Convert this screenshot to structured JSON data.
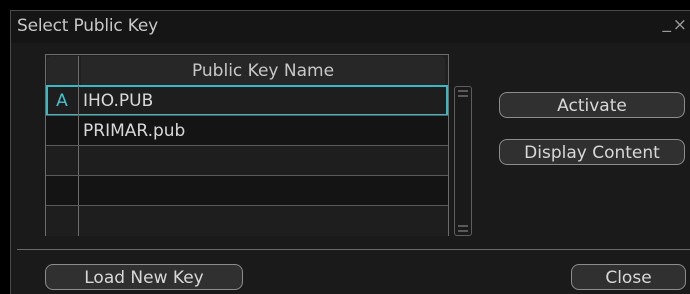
{
  "dialog": {
    "title": "Select Public Key",
    "minimize_glyph": "_",
    "close_glyph": "×"
  },
  "table": {
    "header": {
      "marker": "",
      "name": "Public Key Name"
    },
    "rows": [
      {
        "marker": "A",
        "name": "IHO.PUB"
      },
      {
        "marker": "",
        "name": "PRIMAR.pub"
      },
      {
        "marker": "",
        "name": ""
      },
      {
        "marker": "",
        "name": ""
      },
      {
        "marker": "",
        "name": ""
      }
    ],
    "selected_index": 0
  },
  "buttons": {
    "activate": "Activate",
    "display_content": "Display Content",
    "load_new_key": "Load New Key",
    "close": "Close"
  },
  "colors": {
    "accent": "#39b8c6",
    "marker_text": "#42c4cc",
    "background": "#1a1a1a"
  },
  "icons": {
    "minimize": "minimize-icon",
    "close": "close-icon",
    "scroll_up": "scroll-up-grip-icon",
    "scroll_down": "scroll-down-grip-icon"
  }
}
